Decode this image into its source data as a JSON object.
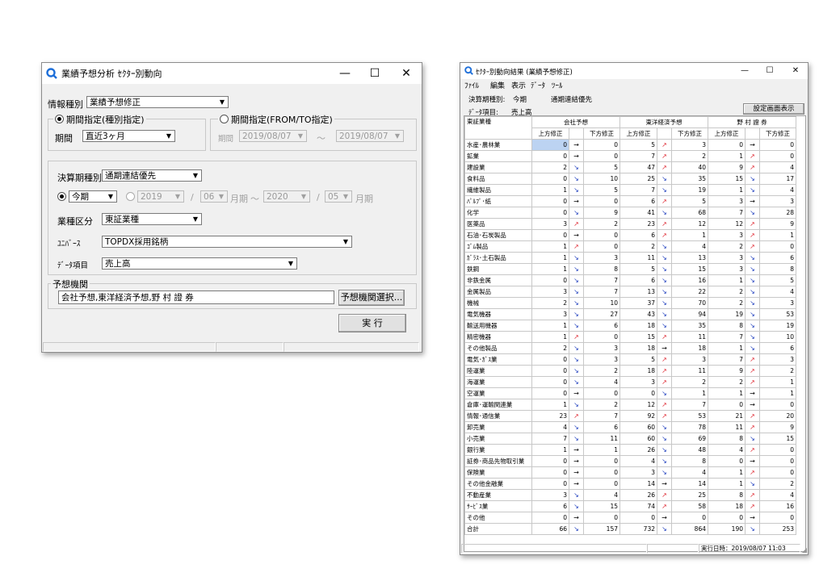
{
  "dialog": {
    "title": "業績予想分析 ｾｸﾀｰ別動向",
    "controls": {
      "minimize": "—",
      "maximize": "☐",
      "close": "✕"
    },
    "info_type_label": "情報種別",
    "info_type_value": "業績予想修正",
    "period_group1_title": "期間指定(種別指定)",
    "period_label": "期間",
    "period_value": "直近3ヶ月",
    "period_group2_title": "期間指定(FROM/TO指定)",
    "period2_label": "期間",
    "period2_from": "2019/08/07",
    "period2_sep": "〜",
    "period2_to": "2019/08/07",
    "settle_type_label": "決算期種別",
    "settle_type_value": "通期連結優先",
    "this_term_label": "今期",
    "year_from": "2019",
    "slash": "/",
    "month_from": "06",
    "month_suffix": "月期",
    "range_sep": "〜",
    "year_to": "2020",
    "month_to": "05",
    "industry_label": "業種区分",
    "industry_value": "東証業種",
    "universe_label": "ﾕﾆﾊﾞｰｽ",
    "universe_value": "TOPDX採用銘柄",
    "data_item_label": "ﾃﾞｰﾀ項目",
    "data_item_value": "売上高",
    "forecaster_group_title": "予想機関",
    "forecaster_value": "会社予想,東洋経済予想,野 村 證 券",
    "forecaster_select_button": "予想機関選択...",
    "run_button": "実 行"
  },
  "result": {
    "title": "ｾｸﾀｰ別動向結果 (業績予想修正)",
    "controls": {
      "minimize": "—",
      "maximize": "☐",
      "close": "✕"
    },
    "menu": [
      "ﾌｧｲﾙ",
      "編集",
      "表示",
      "ﾃﾞｰﾀ",
      "ﾂｰﾙ"
    ],
    "settle_type_label": "決算期種別:",
    "settle_type_term": "今期",
    "settle_type_value": "通期連結優先",
    "data_item_label": "ﾃﾞｰﾀ項目:",
    "data_item_value": "売上高",
    "settings_button": "設定画面表示",
    "table_header": "東証業種",
    "groups": [
      "会社予想",
      "東洋経済予想",
      "野 村 證 券"
    ],
    "subheaders": [
      "上方修正",
      "下方修正"
    ],
    "arrows": {
      "up": "↗",
      "down": "↘",
      "flat": "→"
    },
    "rows": [
      {
        "name": "水産･農林業",
        "v": [
          0,
          "→",
          0,
          5,
          "↗",
          3,
          0,
          "→",
          0
        ]
      },
      {
        "name": "鉱業",
        "v": [
          0,
          "→",
          0,
          7,
          "↗",
          2,
          1,
          "↗",
          0
        ]
      },
      {
        "name": "建設業",
        "v": [
          2,
          "↘",
          5,
          47,
          "↗",
          40,
          9,
          "↗",
          4
        ]
      },
      {
        "name": "食料品",
        "v": [
          0,
          "↘",
          10,
          25,
          "↘",
          35,
          15,
          "↘",
          17
        ]
      },
      {
        "name": "繊維製品",
        "v": [
          1,
          "↘",
          5,
          7,
          "↘",
          19,
          1,
          "↘",
          4
        ]
      },
      {
        "name": "ﾊﾟﾙﾌﾟ･紙",
        "v": [
          0,
          "→",
          0,
          6,
          "↗",
          5,
          3,
          "→",
          3
        ]
      },
      {
        "name": "化学",
        "v": [
          0,
          "↘",
          9,
          41,
          "↘",
          68,
          7,
          "↘",
          28
        ]
      },
      {
        "name": "医薬品",
        "v": [
          3,
          "↗",
          2,
          23,
          "↗",
          12,
          12,
          "↗",
          9
        ]
      },
      {
        "name": "石油･石炭製品",
        "v": [
          0,
          "→",
          0,
          6,
          "↗",
          1,
          3,
          "↗",
          1
        ]
      },
      {
        "name": "ｺﾞﾑ製品",
        "v": [
          1,
          "↗",
          0,
          2,
          "↘",
          4,
          2,
          "↗",
          0
        ]
      },
      {
        "name": "ｶﾞﾗｽ･土石製品",
        "v": [
          1,
          "↘",
          3,
          11,
          "↘",
          13,
          3,
          "↘",
          6
        ]
      },
      {
        "name": "鉄鋼",
        "v": [
          1,
          "↘",
          8,
          5,
          "↘",
          15,
          3,
          "↘",
          8
        ]
      },
      {
        "name": "非鉄金属",
        "v": [
          0,
          "↘",
          7,
          6,
          "↘",
          16,
          1,
          "↘",
          5
        ]
      },
      {
        "name": "金属製品",
        "v": [
          3,
          "↘",
          7,
          13,
          "↘",
          22,
          2,
          "↘",
          4
        ]
      },
      {
        "name": "機械",
        "v": [
          2,
          "↘",
          10,
          37,
          "↘",
          70,
          2,
          "↘",
          3
        ]
      },
      {
        "name": "電気機器",
        "v": [
          3,
          "↘",
          27,
          43,
          "↘",
          94,
          19,
          "↘",
          53
        ]
      },
      {
        "name": "輸送用機器",
        "v": [
          1,
          "↘",
          6,
          18,
          "↘",
          35,
          8,
          "↘",
          19
        ]
      },
      {
        "name": "精密機器",
        "v": [
          1,
          "↗",
          0,
          15,
          "↗",
          11,
          7,
          "↘",
          10
        ]
      },
      {
        "name": "その他製品",
        "v": [
          2,
          "↘",
          3,
          18,
          "→",
          18,
          1,
          "↘",
          6
        ]
      },
      {
        "name": "電気･ｶﾞｽ業",
        "v": [
          0,
          "↘",
          3,
          5,
          "↗",
          3,
          7,
          "↗",
          3
        ]
      },
      {
        "name": "陸運業",
        "v": [
          0,
          "↘",
          2,
          18,
          "↗",
          11,
          9,
          "↗",
          2
        ]
      },
      {
        "name": "海運業",
        "v": [
          0,
          "↘",
          4,
          3,
          "↗",
          2,
          2,
          "↗",
          1
        ]
      },
      {
        "name": "空運業",
        "v": [
          0,
          "→",
          0,
          0,
          "↘",
          1,
          1,
          "→",
          1
        ]
      },
      {
        "name": "倉庫･運輸関連業",
        "v": [
          1,
          "↘",
          2,
          12,
          "↗",
          7,
          0,
          "→",
          0
        ]
      },
      {
        "name": "情報･通信業",
        "v": [
          23,
          "↗",
          7,
          92,
          "↗",
          53,
          21,
          "↗",
          20
        ]
      },
      {
        "name": "卸売業",
        "v": [
          4,
          "↘",
          6,
          60,
          "↘",
          78,
          11,
          "↗",
          9
        ]
      },
      {
        "name": "小売業",
        "v": [
          7,
          "↘",
          11,
          60,
          "↘",
          69,
          8,
          "↘",
          15
        ]
      },
      {
        "name": "銀行業",
        "v": [
          1,
          "→",
          1,
          26,
          "↘",
          48,
          4,
          "↗",
          0
        ]
      },
      {
        "name": "証券･商品先物取引業",
        "v": [
          0,
          "→",
          0,
          4,
          "↘",
          8,
          0,
          "→",
          0
        ]
      },
      {
        "name": "保険業",
        "v": [
          0,
          "→",
          0,
          3,
          "↘",
          4,
          1,
          "↗",
          0
        ]
      },
      {
        "name": "その他金融業",
        "v": [
          0,
          "→",
          0,
          14,
          "→",
          14,
          1,
          "↘",
          2
        ]
      },
      {
        "name": "不動産業",
        "v": [
          3,
          "↘",
          4,
          26,
          "↗",
          25,
          8,
          "↗",
          4
        ]
      },
      {
        "name": "ｻｰﾋﾞｽ業",
        "v": [
          6,
          "↘",
          15,
          74,
          "↗",
          58,
          18,
          "↗",
          16
        ]
      },
      {
        "name": "その他",
        "v": [
          0,
          "→",
          0,
          0,
          "→",
          0,
          0,
          "→",
          0
        ]
      },
      {
        "name": "合計",
        "v": [
          66,
          "↘",
          157,
          732,
          "↘",
          864,
          190,
          "↘",
          253
        ]
      }
    ],
    "status_text": "実行日時：2019/08/07 11:03"
  }
}
